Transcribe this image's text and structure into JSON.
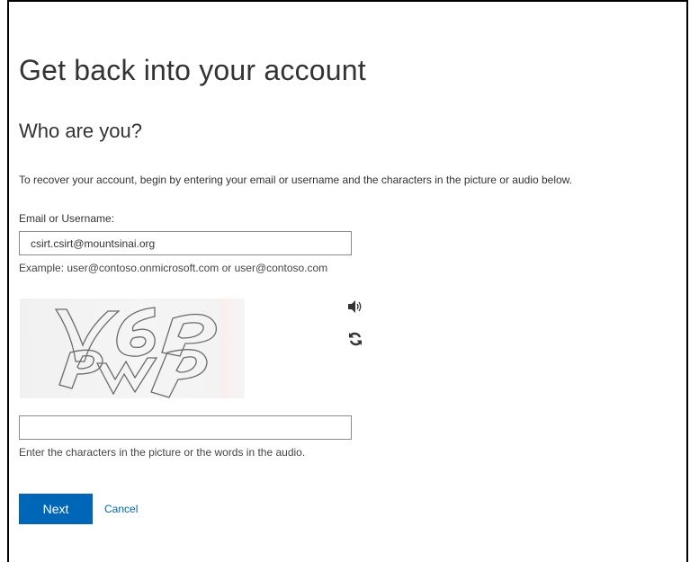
{
  "page": {
    "title": "Get back into your account",
    "subtitle": "Who are you?",
    "instructions": "To recover your account, begin by entering your email or username and the characters in the picture or audio below."
  },
  "email": {
    "label": "Email or Username:",
    "value": "csirt.csirt@mountsinai.org",
    "example": "Example: user@contoso.onmicrosoft.com or user@contoso.com"
  },
  "captcha": {
    "image_text": "V6P PWP",
    "audio_icon": "speaker-icon",
    "refresh_icon": "refresh-icon",
    "input_value": "",
    "hint": "Enter the characters in the picture or the words in the audio."
  },
  "actions": {
    "next_label": "Next",
    "cancel_label": "Cancel"
  },
  "colors": {
    "accent": "#0067b8",
    "text": "#333333"
  }
}
